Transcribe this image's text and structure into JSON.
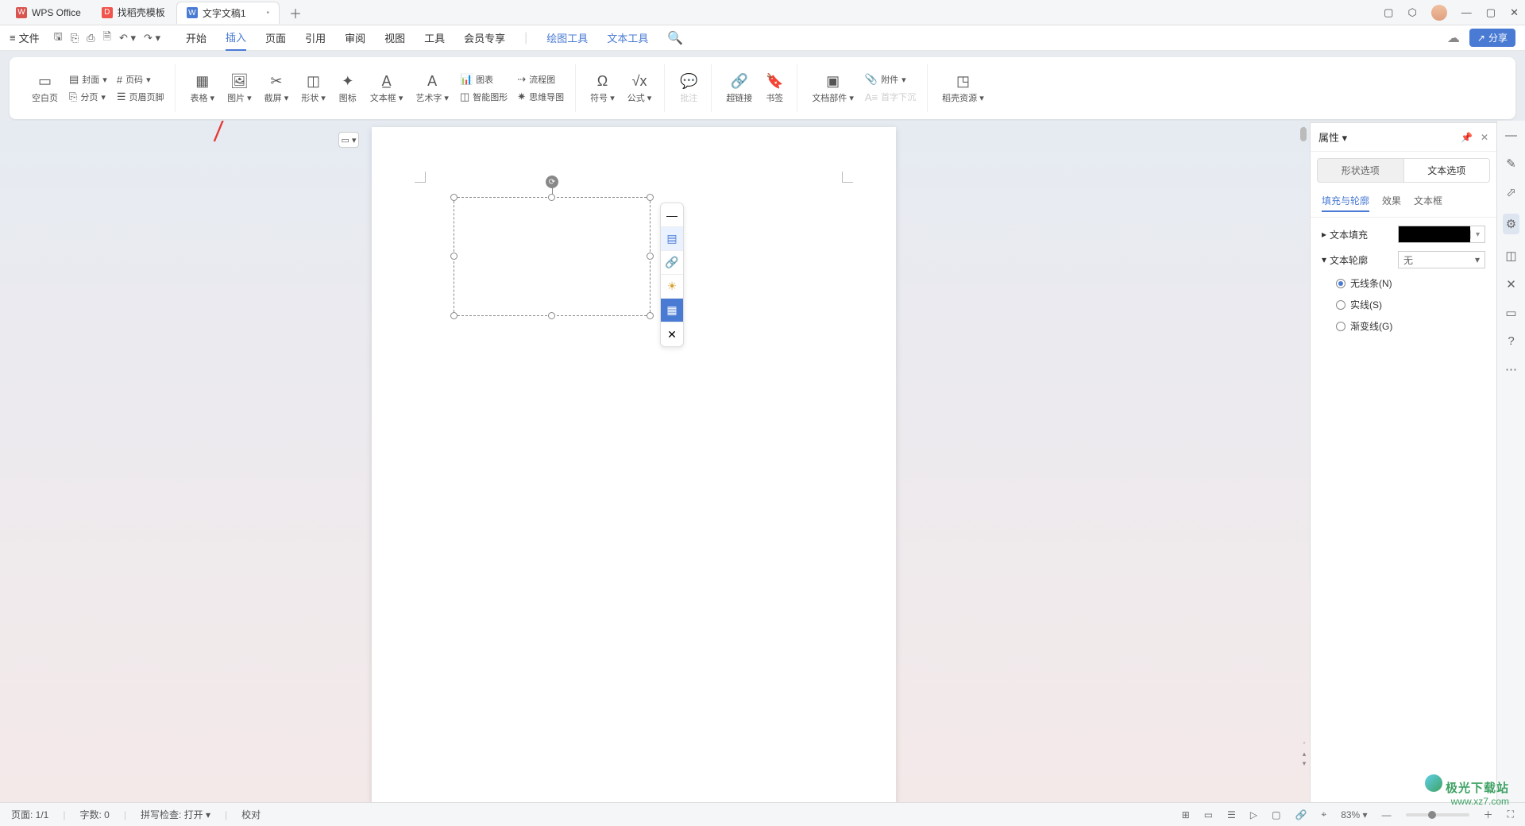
{
  "titleTabs": [
    {
      "label": "WPS Office",
      "icon": "W"
    },
    {
      "label": "找稻壳模板",
      "icon": "D"
    },
    {
      "label": "文字文稿1",
      "icon": "W",
      "active": true
    }
  ],
  "menu": {
    "file": "文件",
    "items": [
      "开始",
      "插入",
      "页面",
      "引用",
      "审阅",
      "视图",
      "工具",
      "会员专享"
    ],
    "extra": [
      "绘图工具",
      "文本工具"
    ],
    "activeIndex": 1,
    "share": "分享"
  },
  "ribbon": {
    "g1a": [
      {
        "label": "空白页",
        "dd": true
      },
      {
        "label": "分页",
        "dd": true
      }
    ],
    "g1b": [
      {
        "label": "封面",
        "dd": true
      },
      {
        "label": "页码",
        "dd": true
      },
      {
        "label": "页眉页脚"
      }
    ],
    "g2": [
      {
        "label": "表格",
        "dd": true
      },
      {
        "label": "图片",
        "dd": true
      },
      {
        "label": "截屏",
        "dd": true
      },
      {
        "label": "形状",
        "dd": true
      },
      {
        "label": "图标"
      },
      {
        "label": "文本框",
        "dd": true
      },
      {
        "label": "艺术字",
        "dd": true
      }
    ],
    "g2b": [
      {
        "label": "图表"
      },
      {
        "label": "智能图形"
      },
      {
        "label": "流程图"
      },
      {
        "label": "思维导图"
      }
    ],
    "g3": [
      {
        "label": "符号",
        "dd": true
      },
      {
        "label": "公式",
        "dd": true
      }
    ],
    "g4": [
      {
        "label": "批注",
        "disabled": true
      }
    ],
    "g5": [
      {
        "label": "超链接"
      },
      {
        "label": "书签"
      }
    ],
    "g6": [
      {
        "label": "文档部件",
        "dd": true
      }
    ],
    "g6b": [
      {
        "label": "附件",
        "dd": true
      },
      {
        "label": "首字下沉",
        "disabled": true
      }
    ],
    "g7": [
      {
        "label": "稻壳资源",
        "dd": true
      }
    ]
  },
  "prop": {
    "title": "属性",
    "tabs": [
      "形状选项",
      "文本选项"
    ],
    "subtabs": [
      "填充与轮廓",
      "效果",
      "文本框"
    ],
    "subActive": 0,
    "fillLabel": "文本填充",
    "outlineLabel": "文本轮廓",
    "outlineValue": "无",
    "radios": [
      "无线条(N)",
      "实线(S)",
      "渐变线(G)"
    ],
    "radioChecked": 0
  },
  "status": {
    "page": "页面: 1/1",
    "words": "字数: 0",
    "spell": "拼写检查: 打开",
    "proof": "校对",
    "zoom": "83%"
  },
  "watermark": {
    "line1": "极光下载站",
    "line2": "www.xz7.com"
  }
}
